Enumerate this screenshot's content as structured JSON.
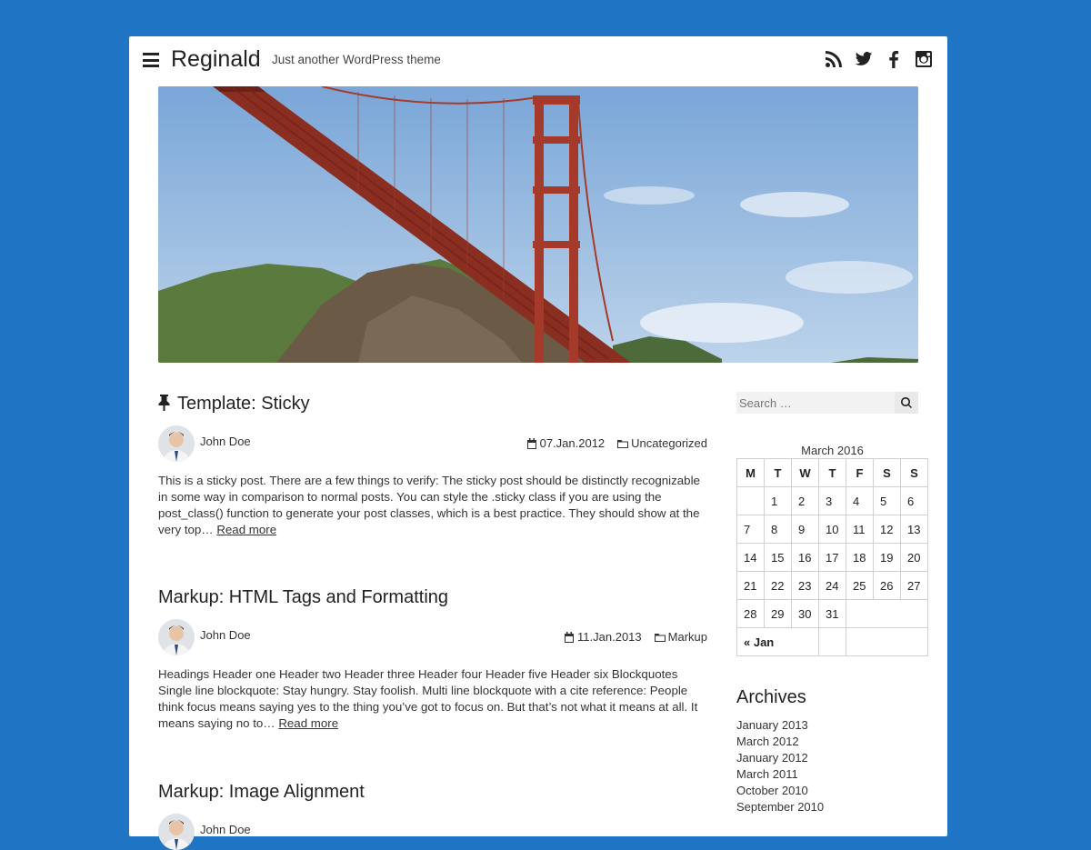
{
  "site": {
    "title": "Reginald",
    "description": "Just another WordPress theme"
  },
  "social_icons": [
    "rss-icon",
    "twitter-icon",
    "facebook-icon",
    "instagram-icon"
  ],
  "colors": {
    "background": "#1f75c3",
    "page": "#ffffff",
    "text": "#222222"
  },
  "posts": [
    {
      "title": "Template: Sticky",
      "sticky": true,
      "author": "John Doe",
      "date": "07.Jan.2012",
      "category": "Uncategorized",
      "excerpt": "This is a sticky post. There are a few things to verify: The sticky post should be distinctly recognizable in some way in comparison to normal posts. You can style the .sticky class if you are using the post_class() function to generate your post classes, which is a best practice. They should show at the very top…",
      "read_more": "Read more"
    },
    {
      "title": "Markup: HTML Tags and Formatting",
      "author": "John Doe",
      "date": "11.Jan.2013",
      "category": "Markup",
      "excerpt": "Headings Header one Header two Header three Header four Header five Header six Blockquotes Single line blockquote: Stay hungry. Stay foolish. Multi line blockquote with a cite reference: People think focus means saying yes to the thing you’ve got to focus on. But that’s not what it means at all. It means saying no to…",
      "read_more": "Read more"
    },
    {
      "title": "Markup: Image Alignment",
      "author": "John Doe"
    }
  ],
  "sidebar": {
    "search_placeholder": "Search …",
    "calendar": {
      "caption": "March 2016",
      "weekdays": [
        "M",
        "T",
        "W",
        "T",
        "F",
        "S",
        "S"
      ],
      "weeks": [
        [
          "",
          "1",
          "2",
          "3",
          "4",
          "5",
          "6"
        ],
        [
          "7",
          "8",
          "9",
          "10",
          "11",
          "12",
          "13"
        ],
        [
          "14",
          "15",
          "16",
          "17",
          "18",
          "19",
          "20"
        ],
        [
          "21",
          "22",
          "23",
          "24",
          "25",
          "26",
          "27"
        ],
        [
          "28",
          "29",
          "30",
          "31",
          "",
          "",
          ""
        ]
      ],
      "prev_link": "« Jan"
    },
    "archives_title": "Archives",
    "archives": [
      "January 2013",
      "March 2012",
      "January 2012",
      "March 2011",
      "October 2010",
      "September 2010"
    ]
  }
}
